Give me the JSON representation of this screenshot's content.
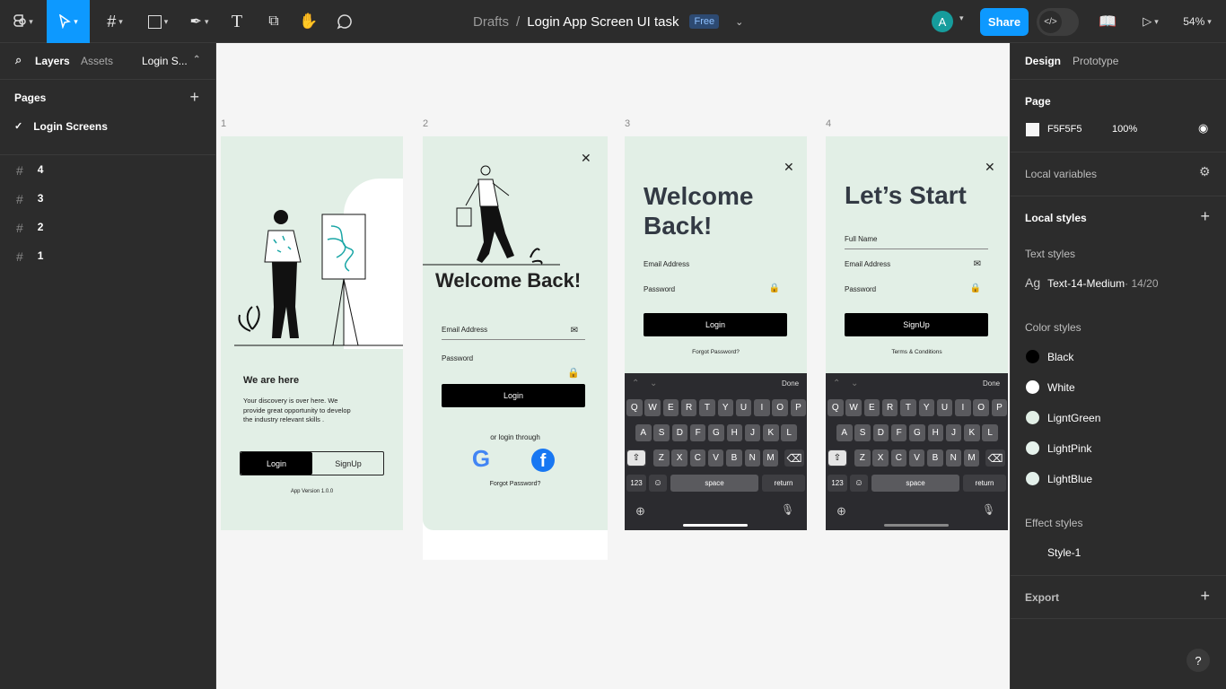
{
  "toolbar": {
    "crumb_parent": "Drafts",
    "separator": "/",
    "file_name": "Login App Screen UI task",
    "plan_badge": "Free",
    "avatar_letter": "A",
    "share_label": "Share",
    "zoom": "54%"
  },
  "left_panel": {
    "tabs": {
      "layers": "Layers",
      "assets": "Assets",
      "page_picker": "Login S..."
    },
    "pages_title": "Pages",
    "current_page": "Login Screens",
    "layers": [
      "4",
      "3",
      "2",
      "1"
    ]
  },
  "right_panel": {
    "tabs": {
      "design": "Design",
      "prototype": "Prototype"
    },
    "page_section": "Page",
    "page_color": "F5F5F5",
    "page_opacity": "100%",
    "local_variables": "Local variables",
    "local_styles": "Local styles",
    "text_styles_title": "Text styles",
    "text_style_glyph": "Ag",
    "text_style_name": "Text-14-Medium",
    "text_style_meta": " · 14/20",
    "color_styles_title": "Color styles",
    "color_styles": [
      {
        "name": "Black",
        "color": "#000000"
      },
      {
        "name": "White",
        "color": "#ffffff"
      },
      {
        "name": "LigntGreen",
        "color": "#e2efe6"
      },
      {
        "name": "LightPink",
        "color": "#e6f2ec"
      },
      {
        "name": "LightBlue",
        "color": "#e3f0ea"
      }
    ],
    "effect_styles_title": "Effect styles",
    "effect_style_name": "Style-1",
    "export_title": "Export",
    "help": "?"
  },
  "frames": {
    "labels": [
      "1",
      "2",
      "3",
      "4"
    ],
    "f1": {
      "heading": "We are here",
      "body": "Your discovery is over here. We provide great opportunity to develop the industry relevant skills .",
      "login": "Login",
      "signup": "SignUp",
      "version": "App Version 1.0.0"
    },
    "f2": {
      "title": "Welcome Back!",
      "email": "Email Address",
      "password": "Password",
      "login": "Login",
      "or": "or login through",
      "forgot": "Forgot Password?"
    },
    "f3": {
      "title": "Welcome Back!",
      "email": "Email Address",
      "password": "Password",
      "login": "Login",
      "forgot": "Forgot Password?"
    },
    "f4": {
      "title": "Let’s Start",
      "fullname": "Full Name",
      "email": "Email Address",
      "password": "Password",
      "signup": "SignUp",
      "terms": "Terms & Conditions"
    }
  },
  "keyboard": {
    "done": "Done",
    "row1": [
      "Q",
      "W",
      "E",
      "R",
      "T",
      "Y",
      "U",
      "I",
      "O",
      "P"
    ],
    "row2": [
      "A",
      "S",
      "D",
      "F",
      "G",
      "H",
      "J",
      "K",
      "L"
    ],
    "row3": [
      "Z",
      "X",
      "C",
      "V",
      "B",
      "N",
      "M"
    ],
    "num": "123",
    "space": "space",
    "return": "return"
  }
}
